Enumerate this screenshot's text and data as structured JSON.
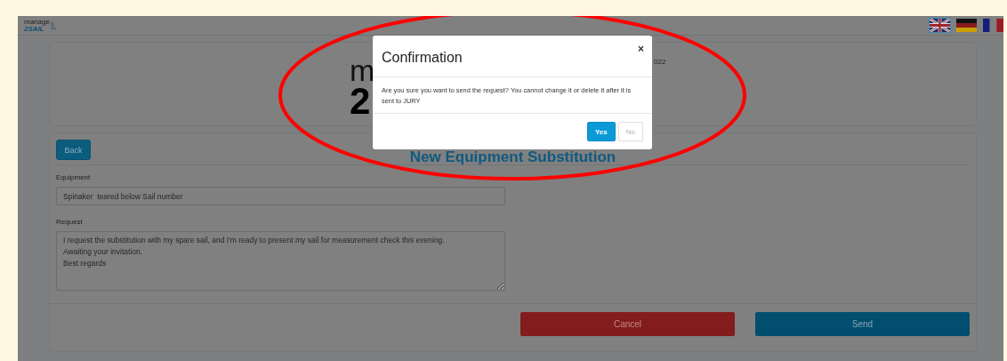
{
  "header": {
    "logo": {
      "line_1": "manage",
      "line_2": "2SAIL"
    },
    "flags": [
      {
        "kind": "uk",
        "selected": true
      },
      {
        "kind": "de",
        "selected": false
      },
      {
        "kind": "fr",
        "selected": false
      }
    ]
  },
  "event_card": {
    "logo": {
      "line_1": "m",
      "line_2": "2"
    },
    "date_fragment": "022"
  },
  "form": {
    "back_button": "Back",
    "title": "New Equipment Substitution",
    "fields": [
      {
        "kind": "input",
        "label": "Equipment",
        "value": "Spinaker  teared below Sail number"
      },
      {
        "kind": "textarea",
        "label": "Request",
        "value": "I request the substitution with my spare sail, and I'm ready to present my sail for measurement check this evening.\nAwaiting your invitation.\nBest regards"
      }
    ],
    "buttons": [
      {
        "kind": "danger",
        "label": "Cancel"
      },
      {
        "kind": "primary",
        "label": "Send"
      }
    ]
  },
  "dialog": {
    "title": "Confirmation",
    "close": "×",
    "message": "Are you sure you want to send the request? You cannot change it or delete it after it is sent to JURY",
    "buttons": [
      {
        "kind": "primary",
        "label": "Yes"
      },
      {
        "kind": "default",
        "label": "No"
      }
    ]
  }
}
